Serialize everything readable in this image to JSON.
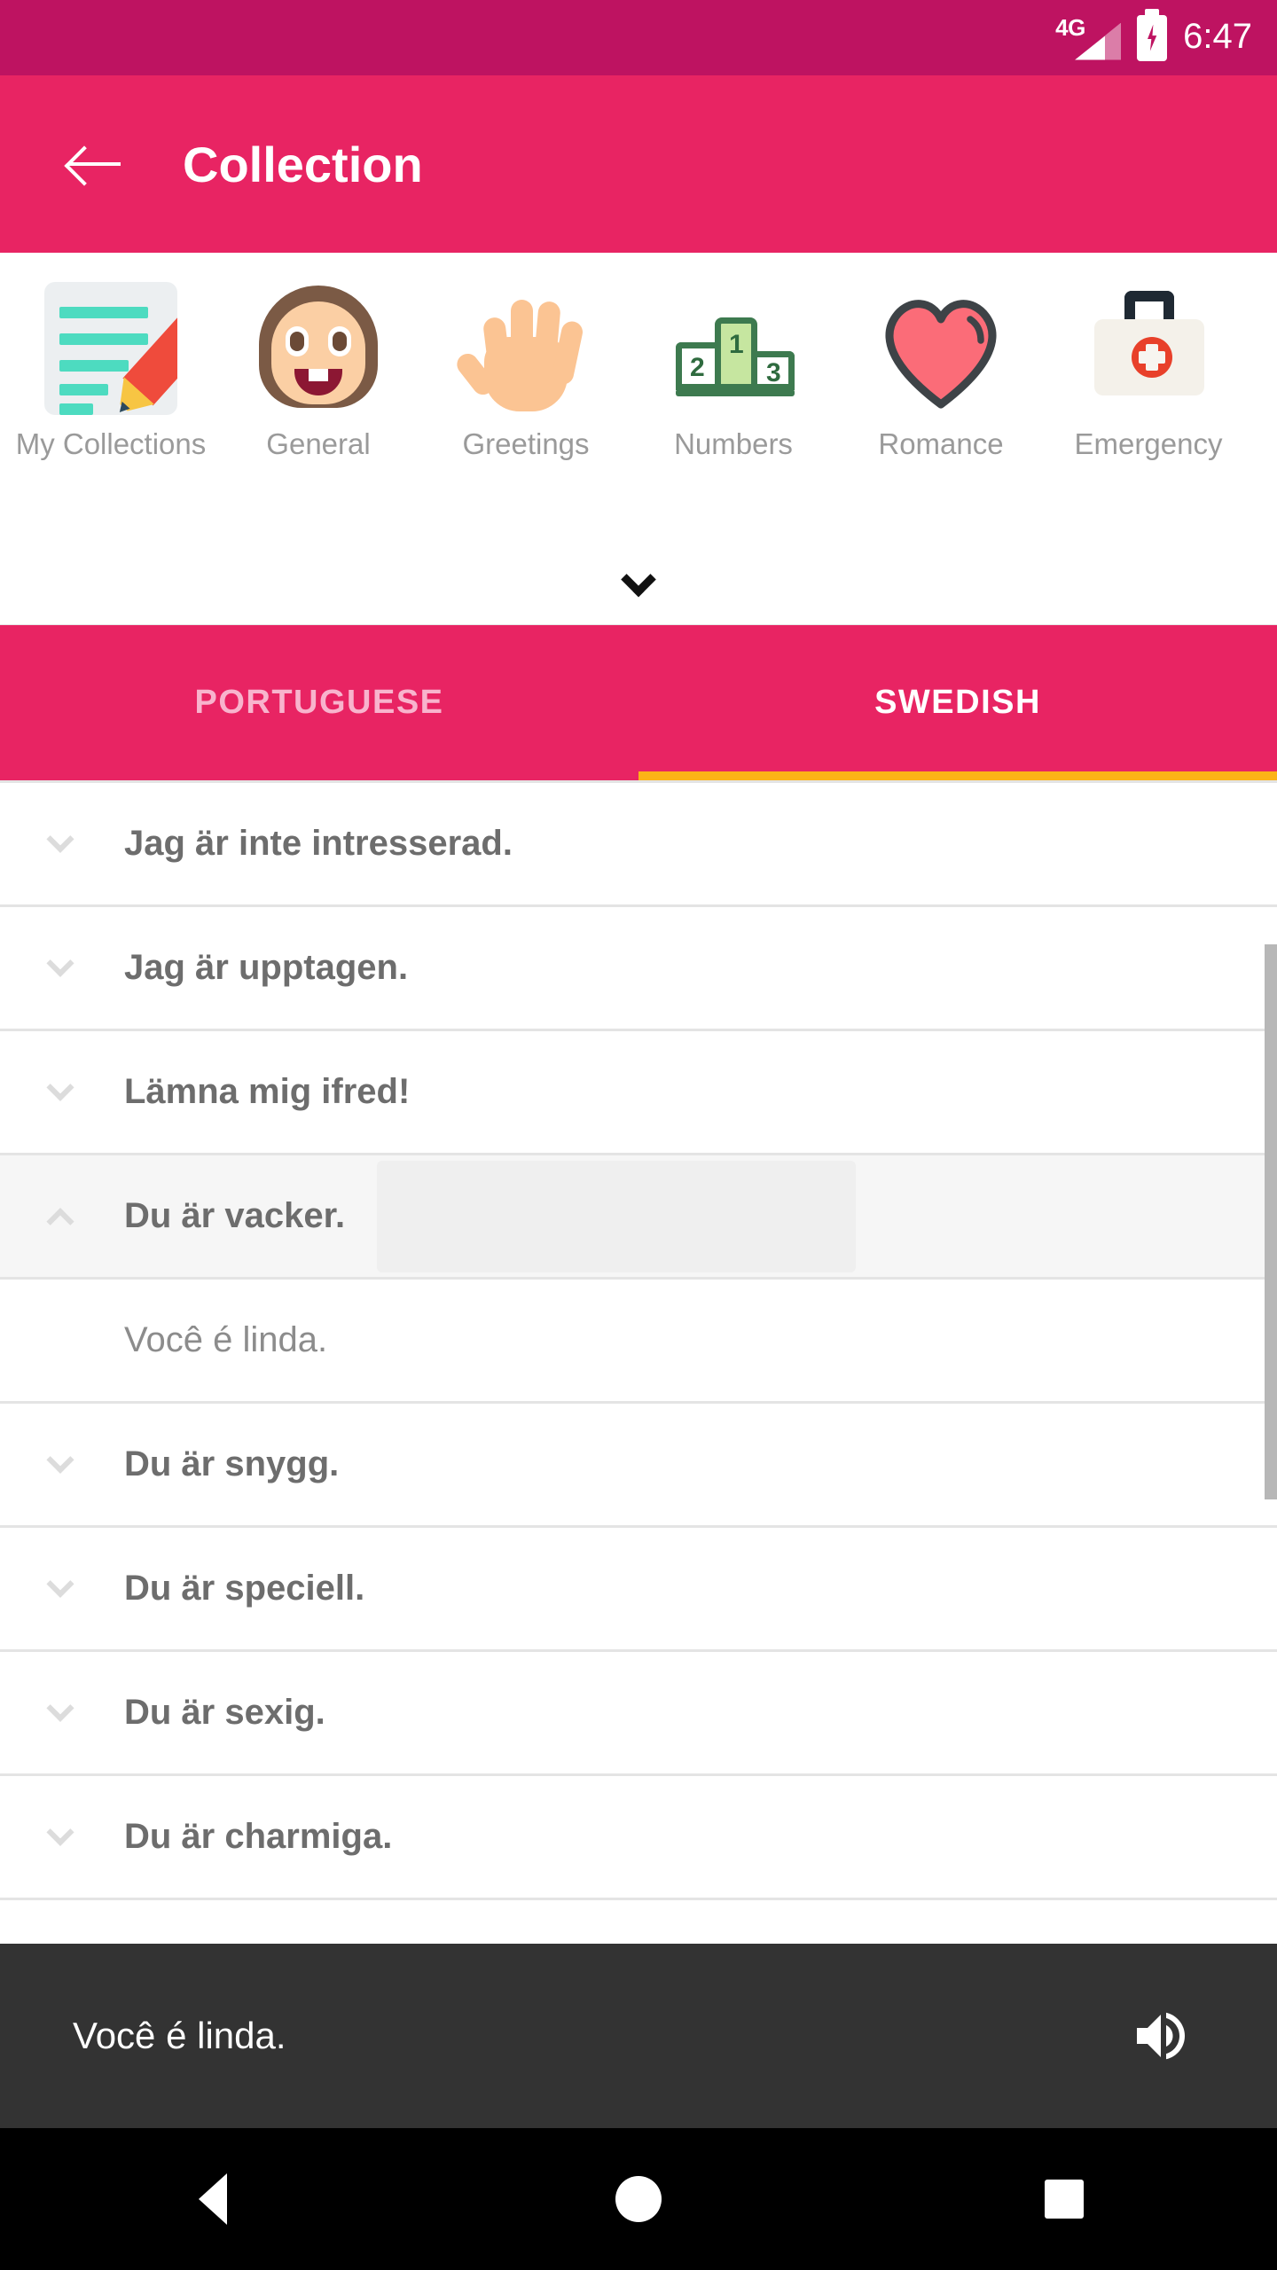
{
  "status_bar": {
    "network": "4G",
    "battery_icon": "battery-charging-icon",
    "time": "6:47"
  },
  "app_bar": {
    "back_icon": "back-arrow-icon",
    "title": "Collection"
  },
  "categories": {
    "expand_icon": "chevron-down-icon",
    "items": [
      {
        "label": "My Collections",
        "icon": "memo-pencil-icon"
      },
      {
        "label": "General",
        "icon": "girl-face-icon"
      },
      {
        "label": "Greetings",
        "icon": "raised-hand-icon"
      },
      {
        "label": "Numbers",
        "icon": "podium-icon"
      },
      {
        "label": "Romance",
        "icon": "heart-icon"
      },
      {
        "label": "Emergency",
        "icon": "first-aid-kit-icon"
      }
    ]
  },
  "tabs": {
    "items": [
      {
        "label": "PORTUGUESE",
        "active": false
      },
      {
        "label": "SWEDISH",
        "active": true
      }
    ],
    "active_indicator_color": "#fcb316"
  },
  "phrase_list": {
    "rows": [
      {
        "text": "Jag är inte intresserad.",
        "expanded": false,
        "chevron": "chevron-down-icon"
      },
      {
        "text": "Jag är upptagen.",
        "expanded": false,
        "chevron": "chevron-down-icon"
      },
      {
        "text": "Lämna mig ifred!",
        "expanded": false,
        "chevron": "chevron-down-icon"
      },
      {
        "text": "Du är vacker.",
        "expanded": true,
        "chevron": "chevron-up-icon",
        "translation": "Você é linda."
      },
      {
        "text": "Du är snygg.",
        "expanded": false,
        "chevron": "chevron-down-icon"
      },
      {
        "text": "Du är speciell.",
        "expanded": false,
        "chevron": "chevron-down-icon"
      },
      {
        "text": "Du är sexig.",
        "expanded": false,
        "chevron": "chevron-down-icon"
      },
      {
        "text": "Du är charmiga.",
        "expanded": false,
        "chevron": "chevron-down-icon"
      }
    ]
  },
  "player": {
    "text": "Você é linda.",
    "speaker_icon": "volume-up-icon"
  },
  "nav_bar": {
    "back": "nav-back-icon",
    "home": "nav-home-icon",
    "recents": "nav-recents-icon"
  },
  "colors": {
    "status_bar": "#be1361",
    "app_bar": "#e82463",
    "tab_bar": "#e82463",
    "tab_indicator": "#fcb316",
    "player_bar": "#333333",
    "nav_bar": "#000000"
  }
}
